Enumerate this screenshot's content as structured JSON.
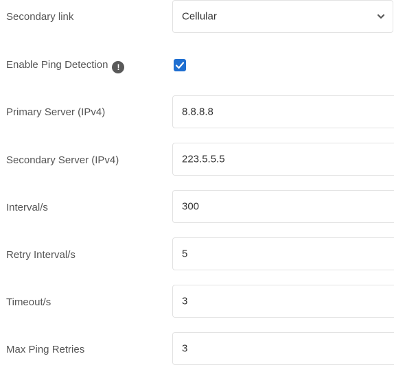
{
  "form": {
    "secondary_link": {
      "label": "Secondary link",
      "value": "Cellular",
      "chevron_icon": "chevron-down-icon"
    },
    "ping_detection": {
      "label": "Enable Ping Detection",
      "info_icon": "info-icon",
      "info_glyph": "!",
      "checked": true
    },
    "primary_server": {
      "label": "Primary Server (IPv4)",
      "value": "8.8.8.8"
    },
    "secondary_server": {
      "label": "Secondary Server (IPv4)",
      "value": "223.5.5.5"
    },
    "interval": {
      "label": "Interval/s",
      "value": "300"
    },
    "retry_interval": {
      "label": "Retry Interval/s",
      "value": "5"
    },
    "timeout": {
      "label": "Timeout/s",
      "value": "3"
    },
    "max_ping_retries": {
      "label": "Max Ping Retries",
      "value": "3"
    }
  },
  "colors": {
    "checkbox_accent": "#1f6fd1",
    "label_text": "#555555",
    "field_border": "#e2e2e2"
  }
}
